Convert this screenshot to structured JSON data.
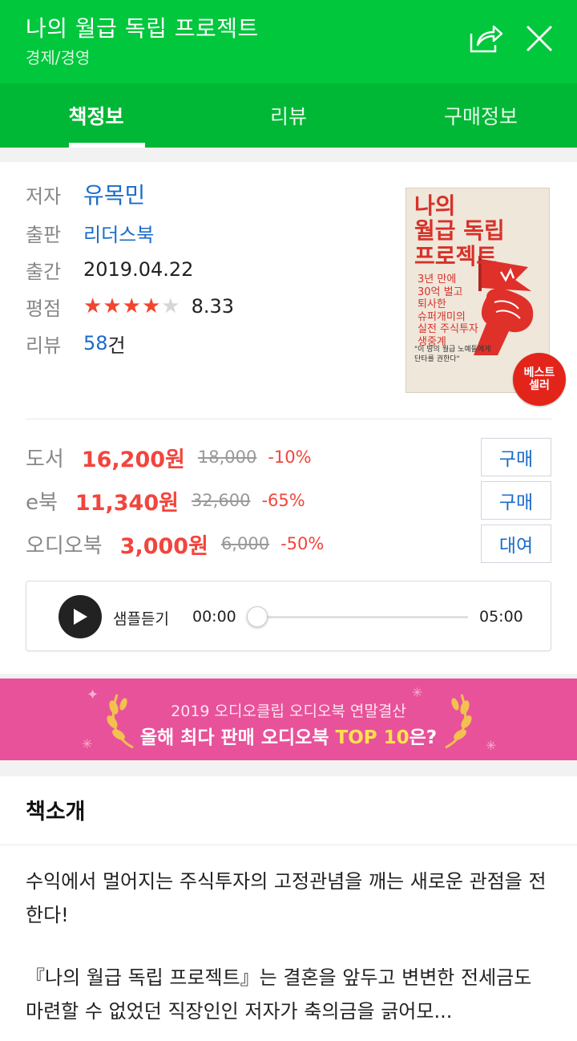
{
  "header": {
    "title": "나의 월급 독립 프로젝트",
    "category": "경제/경영",
    "share_icon": "share-icon",
    "close_icon": "close-icon"
  },
  "tabs": [
    {
      "label": "책정보",
      "active": true
    },
    {
      "label": "리뷰",
      "active": false
    },
    {
      "label": "구매정보",
      "active": false
    }
  ],
  "book": {
    "author_label": "저자",
    "author": "유목민",
    "publisher_label": "출판",
    "publisher": "리더스북",
    "pubdate_label": "출간",
    "pubdate": "2019.04.22",
    "rating_label": "평점",
    "rating_stars": 4.5,
    "rating_value": "8.33",
    "review_label": "리뷰",
    "review_count": "58",
    "review_unit": "건"
  },
  "cover": {
    "title_l1": "나의",
    "title_l2": "월급 독립",
    "title_l3": "프로젝트",
    "sub_l1": "3년 만에",
    "sub_l2": "30억 벌고",
    "sub_l3": "퇴사한",
    "sub_l4": "슈퍼개미의",
    "sub_l5": "실전 주식투자",
    "sub_l6": "생중계",
    "quote_l1": "\"이 땅의 월급 노예들에게",
    "quote_l2": "단타를 권한다\"",
    "badge_l1": "베스트",
    "badge_l2": "셀러"
  },
  "prices": [
    {
      "label": "도서",
      "sale": "16,200원",
      "original": "18,000",
      "discount": "-10%",
      "button": "구매"
    },
    {
      "label": "e북",
      "sale": "11,340원",
      "original": "32,600",
      "discount": "-65%",
      "button": "구매"
    },
    {
      "label": "오디오북",
      "sale": "3,000원",
      "original": "6,000",
      "discount": "-50%",
      "button": "대여"
    }
  ],
  "player": {
    "label": "샘플듣기",
    "current": "00:00",
    "duration": "05:00",
    "progress": 0
  },
  "banner": {
    "line1": "2019 오디오클립 오디오북 연말결산",
    "line2_prefix": "올해 최다 판매 오디오북 ",
    "line2_highlight": "TOP 10",
    "line2_suffix": "은?"
  },
  "intro": {
    "heading": "책소개",
    "para1": "수익에서 멀어지는 주식투자의 고정관념을 깨는 새로운 관점을 전한다!",
    "para2": "『나의 월급 독립 프로젝트』는 결혼을 앞두고 변변한 전세금도 마련할 수 없었던 직장인인 저자가 축의금을 긁어모..."
  },
  "colors": {
    "brand_green": "#00c73c",
    "tab_green": "#00b836",
    "price_red": "#f2453d",
    "link_blue": "#1a6cc9",
    "banner_pink": "#e8529a"
  }
}
